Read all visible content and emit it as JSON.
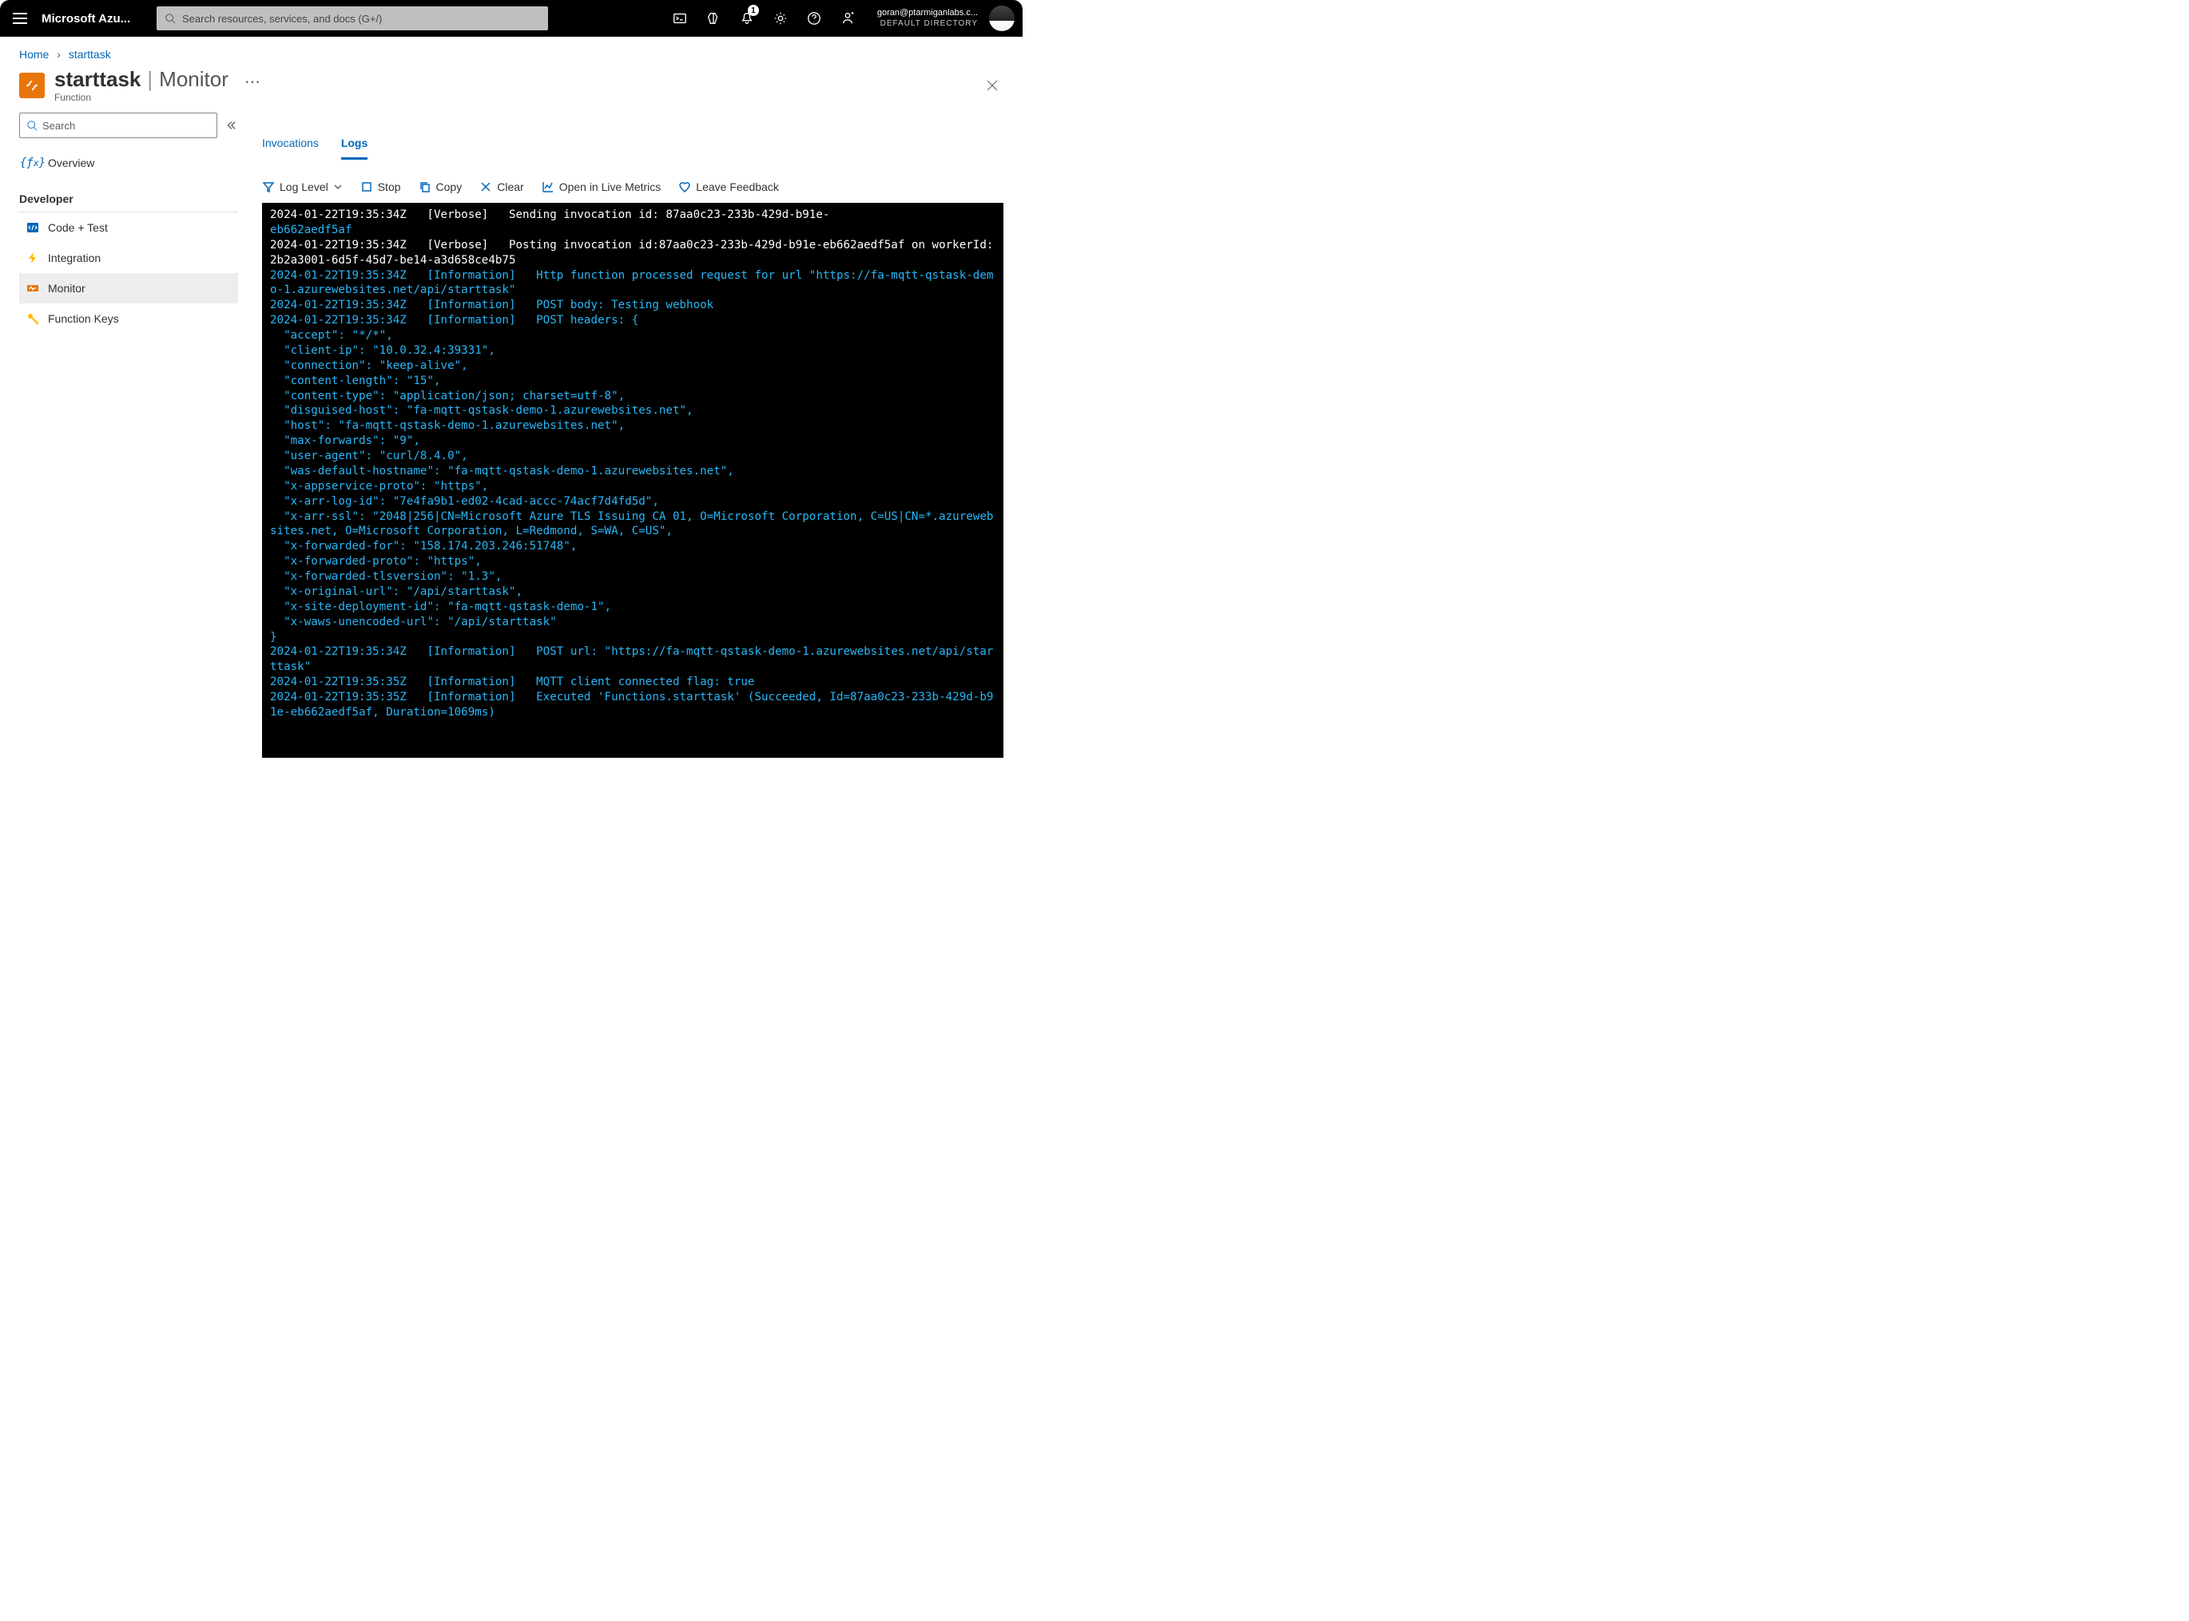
{
  "topbar": {
    "brand": "Microsoft Azu...",
    "search_placeholder": "Search resources, services, and docs (G+/)",
    "notification_count": "1",
    "account_email": "goran@ptarmiganlabs.c...",
    "account_directory": "DEFAULT DIRECTORY"
  },
  "breadcrumb": {
    "home": "Home",
    "current": "starttask"
  },
  "header": {
    "resource_name": "starttask",
    "section": "Monitor",
    "resource_type": "Function"
  },
  "sidebar": {
    "search_placeholder": "Search",
    "overview": "Overview",
    "developer_title": "Developer",
    "items": {
      "code": "Code + Test",
      "integration": "Integration",
      "monitor": "Monitor",
      "keys": "Function Keys"
    }
  },
  "tabs": {
    "invocations": "Invocations",
    "logs": "Logs"
  },
  "toolbar": {
    "loglevel": "Log Level",
    "stop": "Stop",
    "copy": "Copy",
    "clear": "Clear",
    "live": "Open in Live Metrics",
    "feedback": "Leave Feedback"
  },
  "log_lines": [
    {
      "c": "w",
      "t": "2024-01-22T19:35:34Z   [Verbose]   Sending invocation id: 87aa0c23-233b-429d-b91e-"
    },
    {
      "c": "c",
      "t": "eb662aedf5af"
    },
    {
      "c": "w",
      "t": "2024-01-22T19:35:34Z   [Verbose]   Posting invocation id:87aa0c23-233b-429d-b91e-eb662aedf5af on workerId:2b2a3001-6d5f-45d7-be14-a3d658ce4b75"
    },
    {
      "c": "c",
      "t": "2024-01-22T19:35:34Z   [Information]   Http function processed request for url \"https://fa-mqtt-qstask-demo-1.azurewebsites.net/api/starttask\""
    },
    {
      "c": "c",
      "t": "2024-01-22T19:35:34Z   [Information]   POST body: Testing webhook"
    },
    {
      "c": "c",
      "t": "2024-01-22T19:35:34Z   [Information]   POST headers: {"
    },
    {
      "c": "c",
      "t": "  \"accept\": \"*/*\","
    },
    {
      "c": "c",
      "t": "  \"client-ip\": \"10.0.32.4:39331\","
    },
    {
      "c": "c",
      "t": "  \"connection\": \"keep-alive\","
    },
    {
      "c": "c",
      "t": "  \"content-length\": \"15\","
    },
    {
      "c": "c",
      "t": "  \"content-type\": \"application/json; charset=utf-8\","
    },
    {
      "c": "c",
      "t": "  \"disguised-host\": \"fa-mqtt-qstask-demo-1.azurewebsites.net\","
    },
    {
      "c": "c",
      "t": "  \"host\": \"fa-mqtt-qstask-demo-1.azurewebsites.net\","
    },
    {
      "c": "c",
      "t": "  \"max-forwards\": \"9\","
    },
    {
      "c": "c",
      "t": "  \"user-agent\": \"curl/8.4.0\","
    },
    {
      "c": "c",
      "t": "  \"was-default-hostname\": \"fa-mqtt-qstask-demo-1.azurewebsites.net\","
    },
    {
      "c": "c",
      "t": "  \"x-appservice-proto\": \"https\","
    },
    {
      "c": "c",
      "t": "  \"x-arr-log-id\": \"7e4fa9b1-ed02-4cad-accc-74acf7d4fd5d\","
    },
    {
      "c": "c",
      "t": "  \"x-arr-ssl\": \"2048|256|CN=Microsoft Azure TLS Issuing CA 01, O=Microsoft Corporation, C=US|CN=*.azurewebsites.net, O=Microsoft Corporation, L=Redmond, S=WA, C=US\","
    },
    {
      "c": "c",
      "t": "  \"x-forwarded-for\": \"158.174.203.246:51748\","
    },
    {
      "c": "c",
      "t": "  \"x-forwarded-proto\": \"https\","
    },
    {
      "c": "c",
      "t": "  \"x-forwarded-tlsversion\": \"1.3\","
    },
    {
      "c": "c",
      "t": "  \"x-original-url\": \"/api/starttask\","
    },
    {
      "c": "c",
      "t": "  \"x-site-deployment-id\": \"fa-mqtt-qstask-demo-1\","
    },
    {
      "c": "c",
      "t": "  \"x-waws-unencoded-url\": \"/api/starttask\""
    },
    {
      "c": "c",
      "t": "}"
    },
    {
      "c": "c",
      "t": "2024-01-22T19:35:34Z   [Information]   POST url: \"https://fa-mqtt-qstask-demo-1.azurewebsites.net/api/starttask\""
    },
    {
      "c": "c",
      "t": "2024-01-22T19:35:35Z   [Information]   MQTT client connected flag: true"
    },
    {
      "c": "c",
      "t": "2024-01-22T19:35:35Z   [Information]   Executed 'Functions.starttask' (Succeeded, Id=87aa0c23-233b-429d-b91e-eb662aedf5af, Duration=1069ms)"
    }
  ]
}
